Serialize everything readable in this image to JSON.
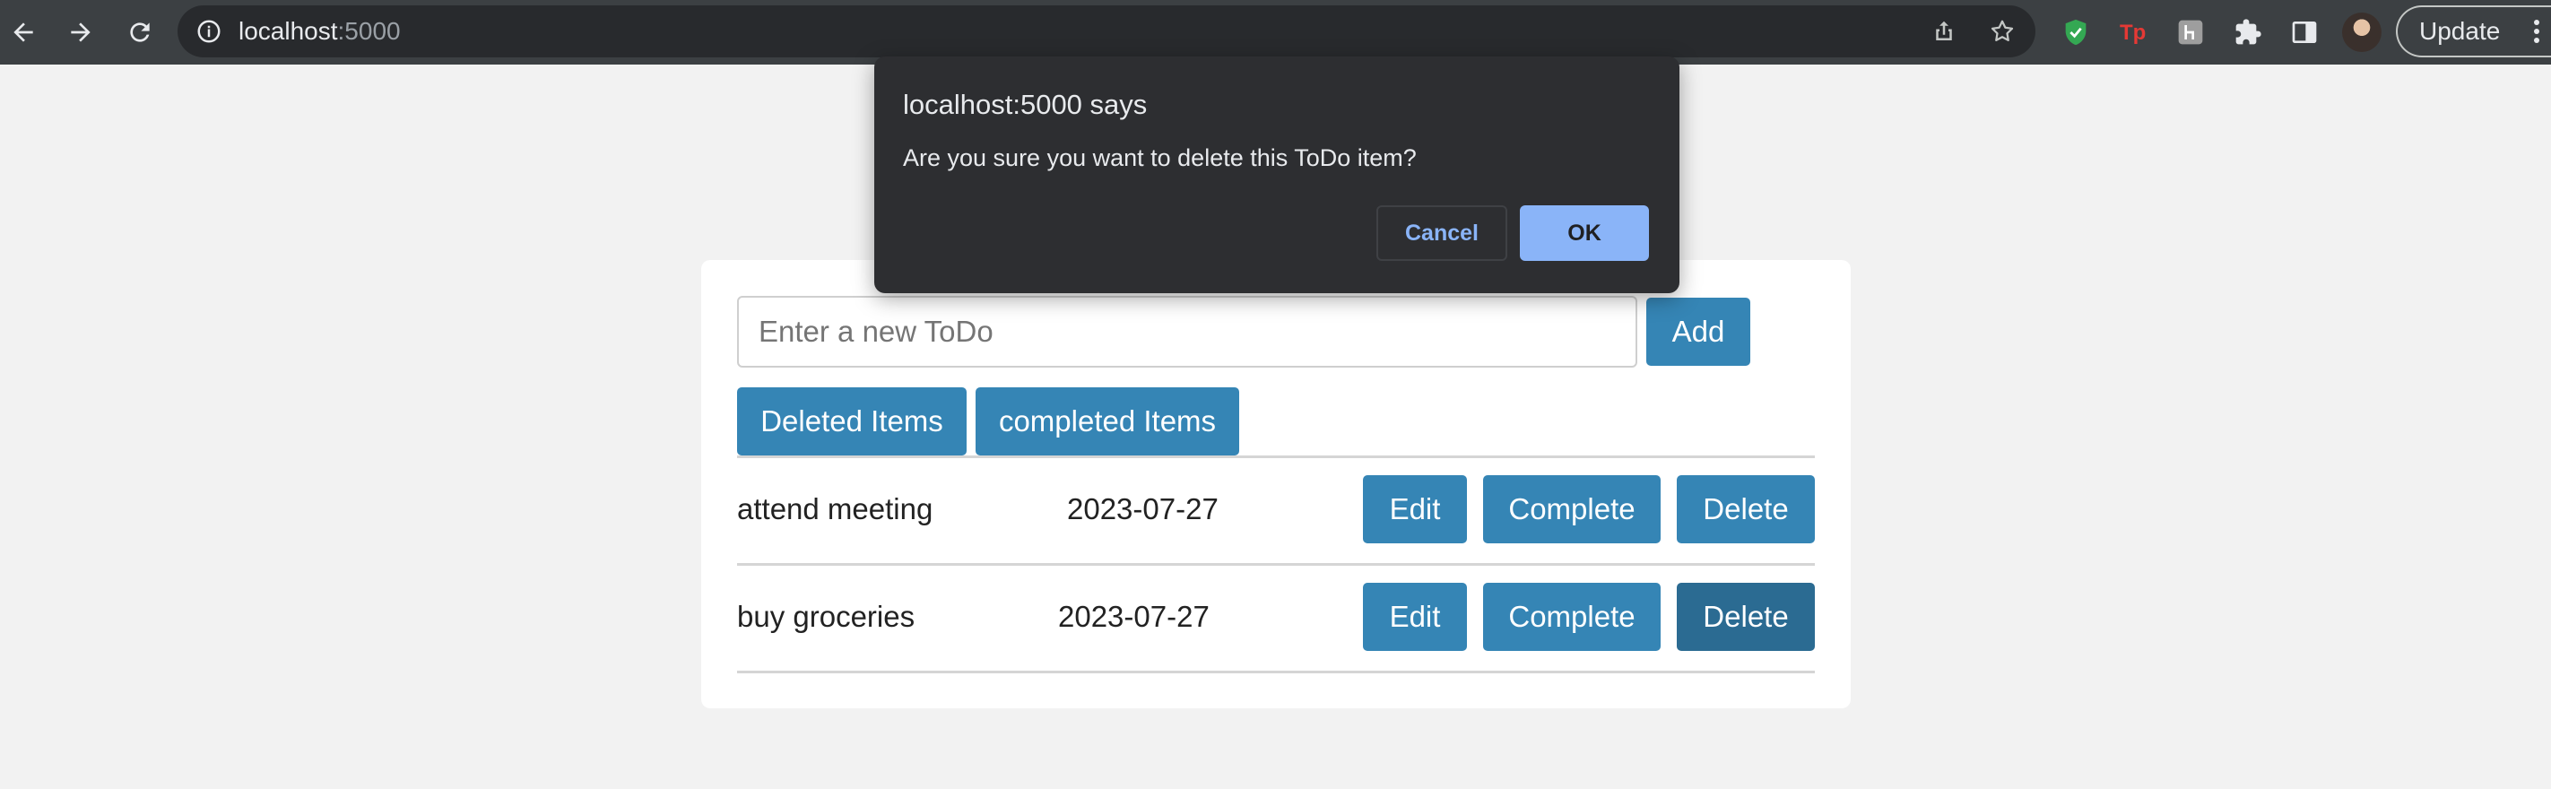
{
  "browser": {
    "url_host": "localhost",
    "url_port": ":5000",
    "update_label": "Update",
    "nav_icons": [
      "back-arrow-icon",
      "forward-arrow-icon",
      "reload-icon"
    ],
    "extensions": [
      "shield-check-extension-icon",
      "tp-extension-icon",
      "h-extension-icon",
      "puzzle-extensions-icon",
      "side-panel-icon"
    ]
  },
  "form": {
    "placeholder": "Enter a new ToDo",
    "add_label": "Add"
  },
  "filters": {
    "deleted_label": "Deleted Items",
    "completed_label": "completed Items"
  },
  "todos": [
    {
      "text": "attend meeting",
      "date": "2023-07-27",
      "edit": "Edit",
      "complete": "Complete",
      "delete": "Delete"
    },
    {
      "text": "buy groceries",
      "date": "2023-07-27",
      "edit": "Edit",
      "complete": "Complete",
      "delete": "Delete"
    }
  ],
  "dialog": {
    "title": "localhost:5000 says",
    "message": "Are you sure you want to delete this ToDo item?",
    "cancel_label": "Cancel",
    "ok_label": "OK"
  },
  "colors": {
    "primary_button": "#3585b5",
    "primary_button_hover": "#2b6b92",
    "dialog_bg": "#2d2e31",
    "dialog_accent": "#8ab4f8"
  }
}
